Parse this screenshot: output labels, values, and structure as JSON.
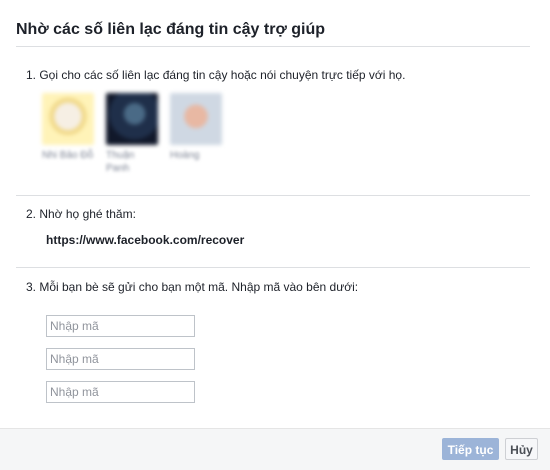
{
  "dialog": {
    "title": "Nhờ các số liên lạc đáng tin cậy trợ giúp"
  },
  "step1": {
    "text": "1. Gọi cho các số liên lạc đáng tin cậy hoặc nói chuyện trực tiếp với họ.",
    "contacts": [
      {
        "name": "Nhi Bảo Đỗ"
      },
      {
        "name": "Thuận Panh"
      },
      {
        "name": "Hoàng"
      }
    ]
  },
  "step2": {
    "text": "2. Nhờ họ ghé thăm:",
    "url": "https://www.facebook.com/recover"
  },
  "step3": {
    "text": "3. Mỗi bạn bè sẽ gửi cho bạn một mã. Nhập mã vào bên dưới:",
    "inputs": [
      {
        "placeholder": "Nhập mã",
        "value": ""
      },
      {
        "placeholder": "Nhập mã",
        "value": ""
      },
      {
        "placeholder": "Nhập mã",
        "value": ""
      }
    ]
  },
  "footer": {
    "continue_label": "Tiếp tục",
    "cancel_label": "Hủy"
  },
  "colors": {
    "continue_button_bg": "#9cb4d8",
    "divider": "#dddfe2",
    "footer_bg": "#f5f6f7"
  }
}
